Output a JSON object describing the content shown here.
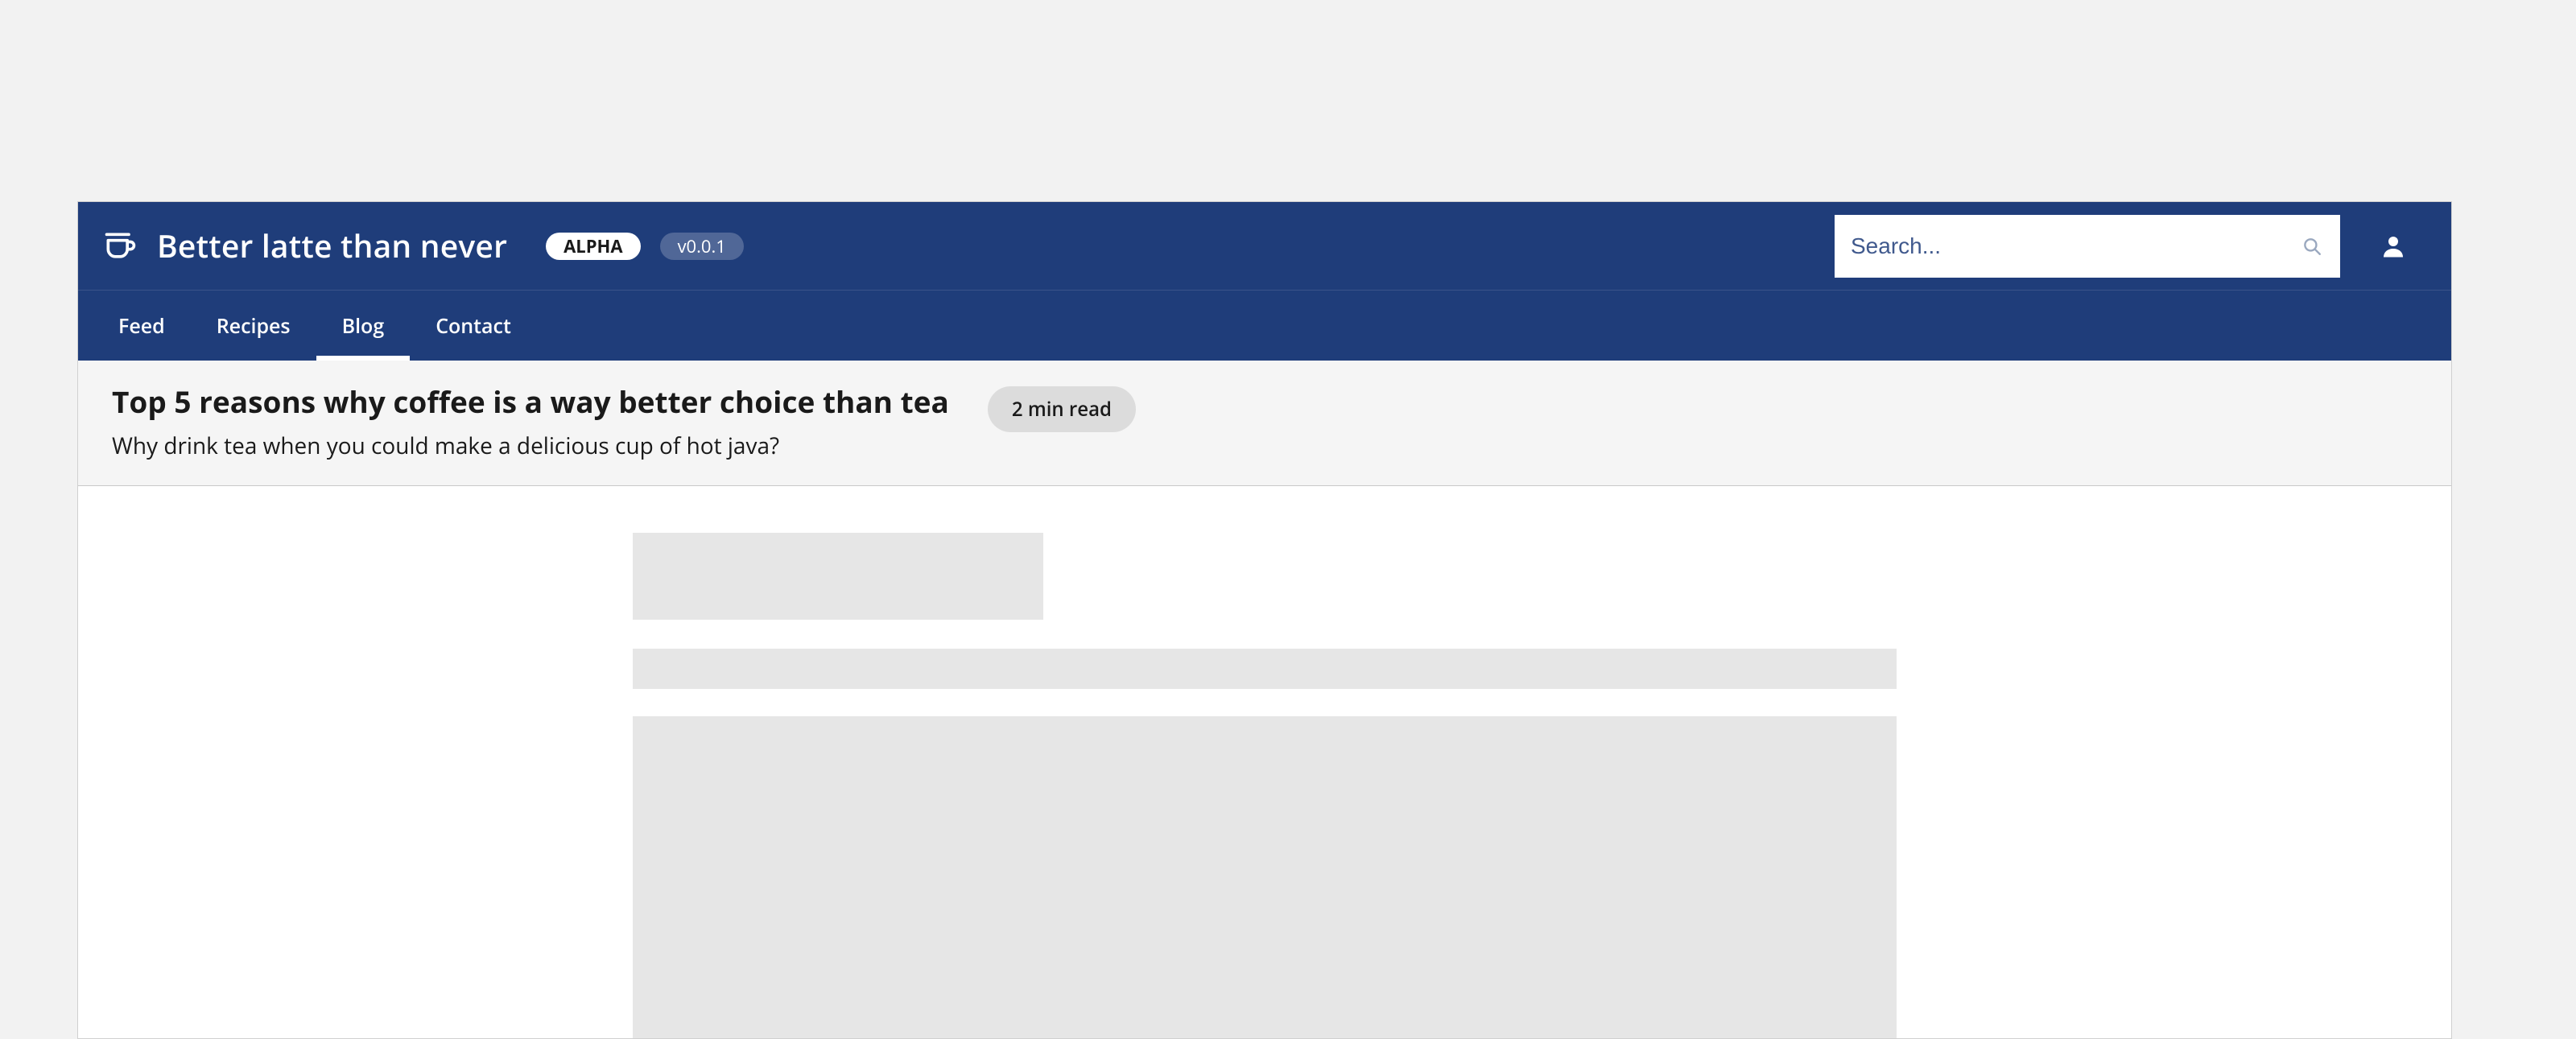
{
  "header": {
    "site_title": "Better latte than never",
    "alpha_badge": "ALPHA",
    "version_badge": "v0.0.1",
    "search_placeholder": "Search..."
  },
  "nav": {
    "items": [
      {
        "label": "Feed",
        "active": false
      },
      {
        "label": "Recipes",
        "active": false
      },
      {
        "label": "Blog",
        "active": true
      },
      {
        "label": "Contact",
        "active": false
      }
    ]
  },
  "page": {
    "title": "Top 5 reasons why coffee is a way better choice than tea",
    "subtitle": "Why drink tea when you could make a delicious cup of hot java?",
    "read_time": "2 min read"
  }
}
